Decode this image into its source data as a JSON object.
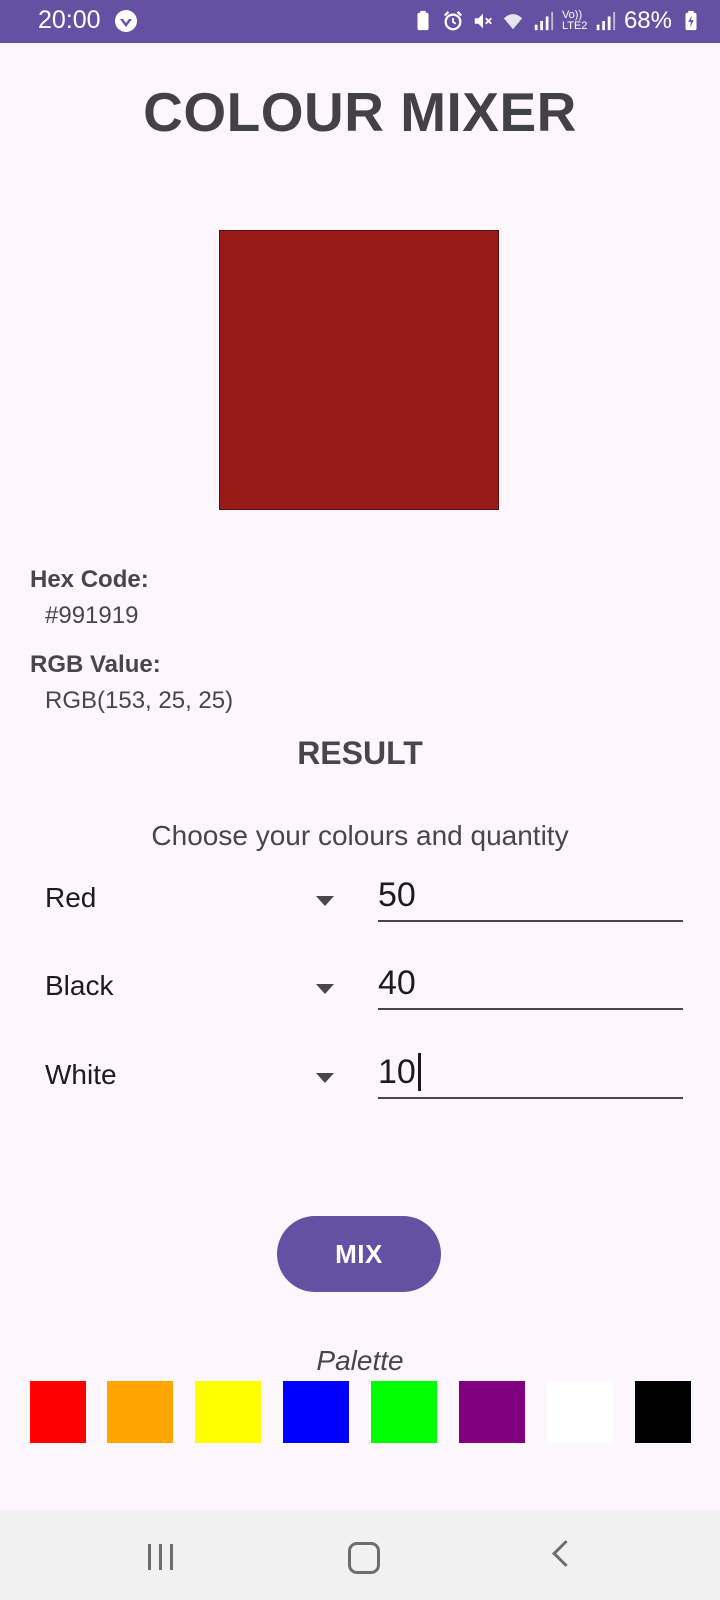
{
  "status_bar": {
    "time": "20:00",
    "battery": "68%",
    "network_label": "Vo)) LTE2"
  },
  "app": {
    "title": "COLOUR MIXER"
  },
  "result": {
    "swatch_color": "#991919",
    "hex_label": "Hex Code:",
    "hex_value": "#991919",
    "rgb_label": "RGB Value:",
    "rgb_value": "RGB(153, 25, 25)",
    "heading": "RESULT"
  },
  "mixer": {
    "instruction": "Choose your colours and quantity",
    "rows": [
      {
        "colour": "Red",
        "quantity": "50"
      },
      {
        "colour": "Black",
        "quantity": "40"
      },
      {
        "colour": "White",
        "quantity": "10"
      }
    ],
    "mix_button": "MIX"
  },
  "palette": {
    "title": "Palette",
    "colors": [
      "#ff0000",
      "#ffa500",
      "#ffff00",
      "#0000ff",
      "#00ff00",
      "#800080",
      "#ffffff",
      "#000000"
    ]
  },
  "colors": {
    "accent": "#6650a4",
    "background": "#fdf7fd"
  }
}
